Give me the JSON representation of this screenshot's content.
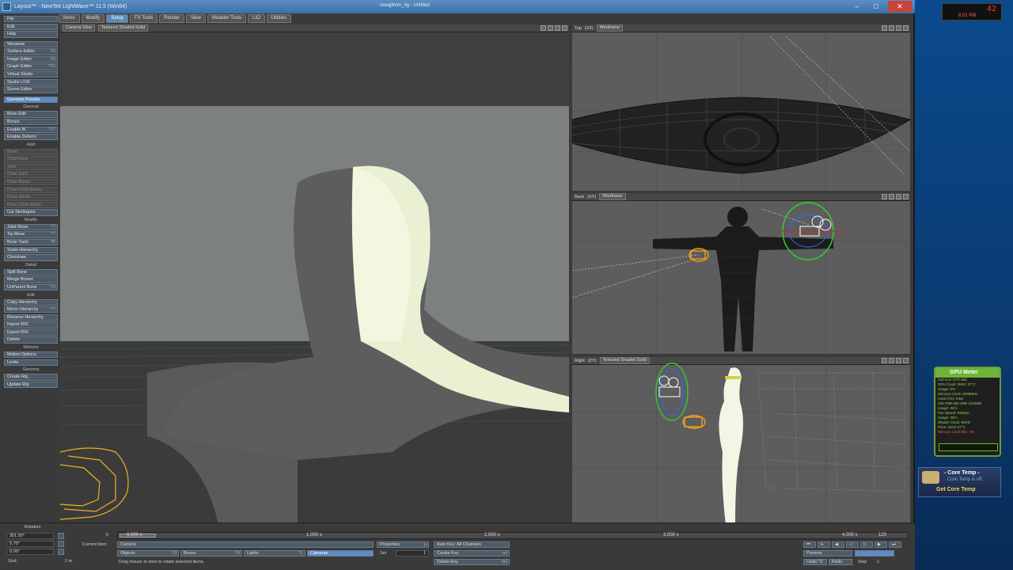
{
  "window": {
    "title": "Layout™ - NewTek LightWave™ 11.5 (Win64)",
    "center_text": "newglimm_rig - Untitled",
    "minimize": "–",
    "maximize": "□",
    "close": "✕"
  },
  "menu_tabs": [
    "Items",
    "Modify",
    "Setup",
    "FX Tools",
    "Render",
    "View",
    "Modeler Tools",
    "LIO",
    "Utilities"
  ],
  "active_tab": "Setup",
  "left_toolbar": {
    "top": [
      {
        "label": "File",
        "shortcut": ""
      },
      {
        "label": "Edit",
        "shortcut": ""
      },
      {
        "label": "Help",
        "shortcut": ""
      }
    ],
    "windows": [
      {
        "label": "Windows",
        "shortcut": ""
      },
      {
        "label": "Surface Editor",
        "shortcut": "F5"
      },
      {
        "label": "Image Editor",
        "shortcut": "F6"
      },
      {
        "label": "Graph Editor",
        "shortcut": "^F2"
      },
      {
        "label": "Virtual Studio",
        "shortcut": ""
      },
      {
        "label": "Studio LIVE",
        "shortcut": ""
      },
      {
        "label": "Scene Editor",
        "shortcut": ""
      }
    ],
    "selected_item": "Genoma Presets",
    "general_header": "General",
    "general": [
      {
        "label": "Bone Edit",
        "shortcut": ""
      },
      {
        "label": "Bones",
        "shortcut": ""
      },
      {
        "label": "Enable IK",
        "shortcut": "^F7"
      },
      {
        "label": "Enable Deform",
        "shortcut": ""
      }
    ],
    "add_header": "Add",
    "add": [
      "Bone",
      "Child Bone",
      "Joint",
      "Child Joint",
      "Draw Bones",
      "Draw Child Bones",
      "Draw Joints",
      "Draw Child Joints"
    ],
    "cut_skelegons": "Cut Skelegons",
    "modify_header": "Modify",
    "modify": [
      {
        "label": "Joint Move",
        "shortcut": "^T"
      },
      {
        "label": "Tip Move",
        "shortcut": "^T"
      },
      {
        "label": "Bone Twist",
        "shortcut": "^R"
      },
      {
        "label": "Scale Hierarchy",
        "shortcut": ""
      },
      {
        "label": "Clenshaw",
        "shortcut": ""
      }
    ],
    "detail_header": "Detail",
    "detail": [
      {
        "label": "Split Bone",
        "shortcut": ""
      },
      {
        "label": "Merge Bones",
        "shortcut": ""
      },
      {
        "label": "UnParent Bone",
        "shortcut": "^U"
      }
    ],
    "edit_header": "Edit",
    "edit": [
      {
        "label": "Copy Hierarchy",
        "shortcut": ""
      },
      {
        "label": "Mirror Hierarchy",
        "shortcut": "^Y"
      },
      {
        "label": "Rename Hierarchy",
        "shortcut": ""
      },
      {
        "label": "Import RIG",
        "shortcut": ""
      },
      {
        "label": "Export RIG",
        "shortcut": ""
      },
      {
        "label": "Delete",
        "shortcut": ""
      }
    ],
    "motions_header": "Motions",
    "motions": [
      {
        "label": "Motion Options",
        "shortcut": ""
      },
      {
        "label": "Limits",
        "shortcut": ""
      }
    ],
    "genoma_header": "Genoma",
    "genoma": [
      {
        "label": "Create Rig",
        "shortcut": ""
      },
      {
        "label": "Update Rig",
        "shortcut": ""
      }
    ]
  },
  "viewports": {
    "camera": {
      "view": "Camera View",
      "shading": "Textured Shaded Solid"
    },
    "top": {
      "view": "Top",
      "axis": "(XZ)",
      "shading": "Wireframe"
    },
    "back": {
      "view": "Back",
      "axis": "(XY)",
      "shading": "Wireframe"
    },
    "right": {
      "view": "Right",
      "axis": "(ZY)",
      "shading": "Textured Shaded Solid"
    }
  },
  "bottom": {
    "rotation_label": "Rotation",
    "h_value": "301.50°",
    "p_value": "5.70°",
    "b_value": "0.00°",
    "grid_label": "Grid:",
    "grid_value": "2 m",
    "frame_start": "0",
    "current_item_label": "Current Item",
    "current_item": "Camera",
    "timeline_labels": [
      "0.000 s",
      "1.000 s",
      "2.000 s",
      "3.000 s",
      "4.000 s"
    ],
    "frame_end": "120",
    "objects_label": "Objects",
    "objects_sc": "^O",
    "bones_label": "Bones",
    "bones_sc": "^B",
    "lights_label": "Lights",
    "lights_sc": "^L",
    "cameras_label": "Cameras",
    "properties_label": "Properties",
    "properties_sc": "p",
    "set_label": "Set",
    "set_value": "1",
    "autokey_label": "Auto Key: All Channels",
    "create_key": "Create Key",
    "create_key_sc": "ret",
    "delete_key": "Delete Key",
    "delete_key_sc": "del",
    "status": "Drag mouse in view to rotate selected items.",
    "preview": "Preview",
    "undo": "Undo ^Z",
    "redo": "Redo",
    "step_label": "Step",
    "step_value": "1"
  },
  "tray": {
    "big": "42",
    "small": "6:01 PM"
  },
  "gpu_meter": {
    "title": "GPU Meter",
    "lines": [
      "GeForce GTX 660",
      "GPU Clock: 0MHz   37°C",
      "Usage: 0%",
      "Memory Clock: 6008MHz",
      "Used  Free  Total",
      "343.7MB  680.4MB  1024MB",
      "Usage: 34%",
      "Fan Speed: 930rpm",
      "Usage: 30%",
      "Shader Clock: 0MHz",
      "PCIe: Gen2 27°C"
    ],
    "red_line": "Memory Controller: 3%"
  },
  "core_temp": {
    "title": "- Core Temp -",
    "status": "Core Temp is off.",
    "action": "Get Core Temp"
  },
  "colors": {
    "accent": "#5b8cc8",
    "bone_orange": "#f0a020",
    "light_green": "#33cc33",
    "gadget_green": "#6fb33a"
  }
}
